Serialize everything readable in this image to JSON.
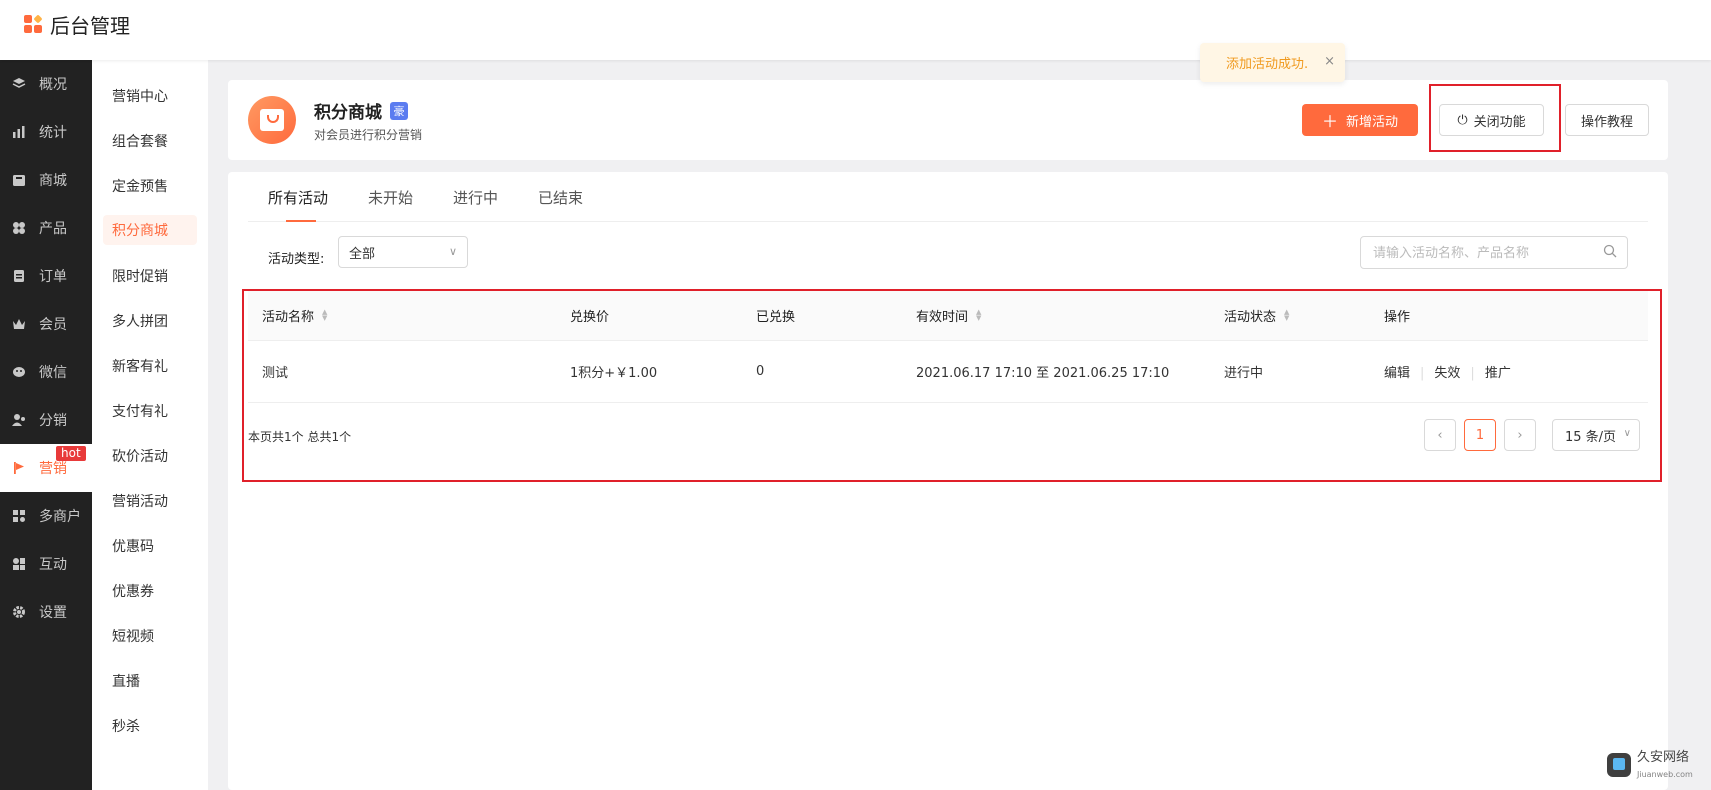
{
  "app": {
    "title": "后台管理"
  },
  "sidebar": {
    "items": [
      {
        "label": "概况",
        "icon": "layers-icon"
      },
      {
        "label": "统计",
        "icon": "chart-icon"
      },
      {
        "label": "商城",
        "icon": "store-icon"
      },
      {
        "label": "产品",
        "icon": "product-icon"
      },
      {
        "label": "订单",
        "icon": "order-icon"
      },
      {
        "label": "会员",
        "icon": "crown-icon"
      },
      {
        "label": "微信",
        "icon": "wechat-icon"
      },
      {
        "label": "分销",
        "icon": "distribution-icon"
      },
      {
        "label": "营销",
        "icon": "flag-icon",
        "badge": "hot"
      },
      {
        "label": "多商户",
        "icon": "multi-store-icon"
      },
      {
        "label": "互动",
        "icon": "interact-icon"
      },
      {
        "label": "设置",
        "icon": "gear-icon"
      }
    ]
  },
  "subnav": {
    "items": [
      "营销中心",
      "组合套餐",
      "定金预售",
      "积分商城",
      "限时促销",
      "多人拼团",
      "新客有礼",
      "支付有礼",
      "砍价活动",
      "营销活动",
      "优惠码",
      "优惠券",
      "短视频",
      "直播",
      "秒杀"
    ]
  },
  "toast": {
    "text": "添加活动成功.",
    "close": "×"
  },
  "header": {
    "title": "积分商城",
    "tag": "豪",
    "subtitle": "对会员进行积分营销",
    "add_button": "新增活动",
    "add_button_icon": "＋",
    "close_button": "关闭功能",
    "close_button_icon": "⏻",
    "tutorial_button": "操作教程"
  },
  "tabs": [
    "所有活动",
    "未开始",
    "进行中",
    "已结束"
  ],
  "filter": {
    "label": "活动类型:",
    "selected": "全部",
    "search_placeholder": "请输入活动名称、产品名称"
  },
  "table": {
    "headers": [
      "活动名称",
      "兑换价",
      "已兑换",
      "有效时间",
      "活动状态",
      "操作"
    ],
    "rows": [
      {
        "name": "测试",
        "price": "1积分+￥1.00",
        "redeemed": "0",
        "time": "2021.06.17 17:10 至 2021.06.25 17:10",
        "status": "进行中",
        "ops": [
          "编辑",
          "失效",
          "推广"
        ]
      }
    ]
  },
  "pagination": {
    "info": "本页共1个 总共1个",
    "current": "1",
    "prev": "‹",
    "next": "›",
    "page_size": "15 条/页"
  },
  "watermark": {
    "text": "久安网络",
    "sub": "Jiuanweb.com"
  },
  "colors": {
    "accent": "#ff6a3d",
    "highlight": "#e0202a",
    "sidebar": "#222222",
    "toast": "#f09a1f"
  }
}
